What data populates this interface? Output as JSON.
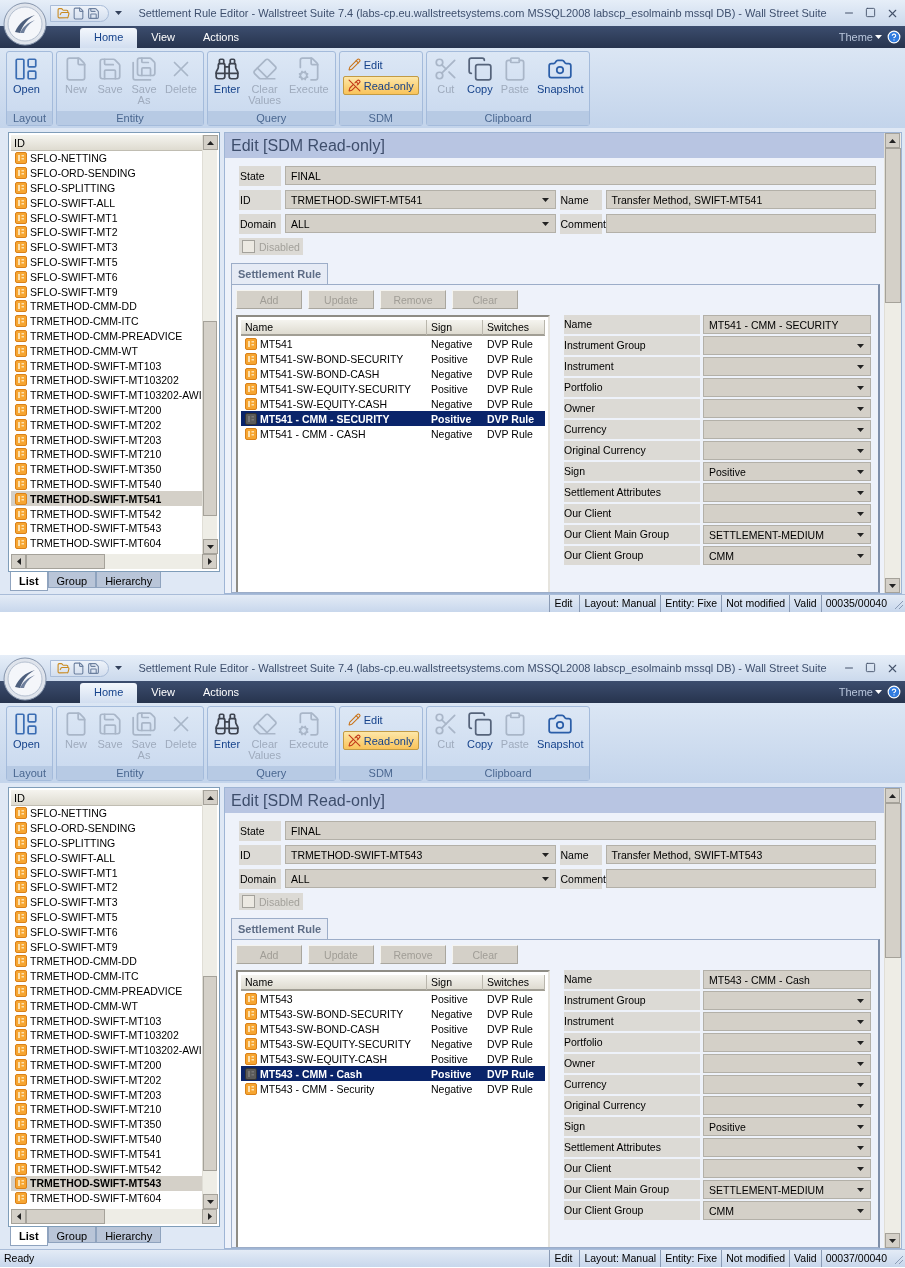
{
  "windows": [
    {
      "title": "Settlement Rule Editor - Wallstreet Suite 7.4 (labs-cp.eu.wallstreetsystems.com MSSQL2008 labscp_esolmainb mssql DB) - Wall Street Suite",
      "ribbon": {
        "tabs": [
          {
            "label": "Home",
            "selected": true
          },
          {
            "label": "View",
            "selected": false
          },
          {
            "label": "Actions",
            "selected": false
          }
        ],
        "theme": "Theme",
        "groups": [
          {
            "label": "Layout",
            "kind": "large",
            "buttons": [
              {
                "label": "Open",
                "disabled": false
              }
            ]
          },
          {
            "label": "Entity",
            "kind": "large",
            "buttons": [
              {
                "label": "New",
                "disabled": true
              },
              {
                "label": "Save",
                "disabled": true
              },
              {
                "label": "Save\nAs",
                "disabled": true
              },
              {
                "label": "Delete",
                "disabled": true
              }
            ]
          },
          {
            "label": "Query",
            "kind": "large",
            "buttons": [
              {
                "label": "Enter",
                "disabled": false
              },
              {
                "label": "Clear\nValues",
                "disabled": true
              },
              {
                "label": "Execute",
                "disabled": true
              }
            ]
          },
          {
            "label": "SDM",
            "kind": "toggles",
            "buttons": [
              {
                "label": "Edit",
                "selected": false
              },
              {
                "label": "Read-only",
                "selected": true
              }
            ]
          },
          {
            "label": "Clipboard",
            "kind": "large",
            "buttons": [
              {
                "label": "Cut",
                "disabled": true
              },
              {
                "label": "Copy",
                "disabled": false
              },
              {
                "label": "Paste",
                "disabled": true
              },
              {
                "label": "Snapshot",
                "disabled": false
              }
            ]
          }
        ]
      },
      "sidebar": {
        "column": "ID",
        "items": [
          {
            "label": "SFLO-NETTING",
            "selected": false
          },
          {
            "label": "SFLO-ORD-SENDING",
            "selected": false
          },
          {
            "label": "SFLO-SPLITTING",
            "selected": false
          },
          {
            "label": "SFLO-SWIFT-ALL",
            "selected": false
          },
          {
            "label": "SFLO-SWIFT-MT1",
            "selected": false
          },
          {
            "label": "SFLO-SWIFT-MT2",
            "selected": false
          },
          {
            "label": "SFLO-SWIFT-MT3",
            "selected": false
          },
          {
            "label": "SFLO-SWIFT-MT5",
            "selected": false
          },
          {
            "label": "SFLO-SWIFT-MT6",
            "selected": false
          },
          {
            "label": "SFLO-SWIFT-MT9",
            "selected": false
          },
          {
            "label": "TRMETHOD-CMM-DD",
            "selected": false
          },
          {
            "label": "TRMETHOD-CMM-ITC",
            "selected": false
          },
          {
            "label": "TRMETHOD-CMM-PREADVICE",
            "selected": false
          },
          {
            "label": "TRMETHOD-CMM-WT",
            "selected": false
          },
          {
            "label": "TRMETHOD-SWIFT-MT103",
            "selected": false
          },
          {
            "label": "TRMETHOD-SWIFT-MT103202",
            "selected": false
          },
          {
            "label": "TRMETHOD-SWIFT-MT103202-AWI",
            "selected": false
          },
          {
            "label": "TRMETHOD-SWIFT-MT200",
            "selected": false
          },
          {
            "label": "TRMETHOD-SWIFT-MT202",
            "selected": false
          },
          {
            "label": "TRMETHOD-SWIFT-MT203",
            "selected": false
          },
          {
            "label": "TRMETHOD-SWIFT-MT210",
            "selected": false
          },
          {
            "label": "TRMETHOD-SWIFT-MT350",
            "selected": false
          },
          {
            "label": "TRMETHOD-SWIFT-MT540",
            "selected": false
          },
          {
            "label": "TRMETHOD-SWIFT-MT541",
            "selected": true
          },
          {
            "label": "TRMETHOD-SWIFT-MT542",
            "selected": false
          },
          {
            "label": "TRMETHOD-SWIFT-MT543",
            "selected": false
          },
          {
            "label": "TRMETHOD-SWIFT-MT604",
            "selected": false
          }
        ],
        "tabs": [
          {
            "label": "List",
            "selected": true
          },
          {
            "label": "Group",
            "selected": false
          },
          {
            "label": "Hierarchy",
            "selected": false
          }
        ]
      },
      "editor": {
        "heading": "Edit [SDM Read-only]",
        "form_rows": [
          [
            {
              "label": "State",
              "value": "FINAL",
              "kind": "text"
            }
          ],
          [
            {
              "label": "ID",
              "value": "TRMETHOD-SWIFT-MT541",
              "kind": "dropdown"
            },
            {
              "label": "Name",
              "value": "Transfer Method, SWIFT-MT541",
              "kind": "text"
            }
          ],
          [
            {
              "label": "Domain",
              "value": "ALL",
              "kind": "dropdown"
            },
            {
              "label": "Comment",
              "kind": "text"
            }
          ]
        ],
        "checkbox": {
          "label": "Disabled",
          "checked": false,
          "disabled": true
        },
        "tab": "Settlement Rule",
        "actions": [
          {
            "label": "Add",
            "disabled": true
          },
          {
            "label": "Update",
            "disabled": true
          },
          {
            "label": "Remove",
            "disabled": true
          },
          {
            "label": "Clear",
            "disabled": true
          }
        ],
        "rules": {
          "columns": [
            "Name",
            "Sign",
            "Switches"
          ],
          "rows": [
            {
              "name": "MT541",
              "sign": "Negative",
              "switches": "DVP Rule",
              "selected": false
            },
            {
              "name": "MT541-SW-BOND-SECURITY",
              "sign": "Positive",
              "switches": "DVP Rule",
              "selected": false
            },
            {
              "name": "MT541-SW-BOND-CASH",
              "sign": "Negative",
              "switches": "DVP Rule",
              "selected": false
            },
            {
              "name": "MT541-SW-EQUITY-SECURITY",
              "sign": "Positive",
              "switches": "DVP Rule",
              "selected": false
            },
            {
              "name": "MT541-SW-EQUITY-CASH",
              "sign": "Negative",
              "switches": "DVP Rule",
              "selected": false
            },
            {
              "name": "MT541 - CMM - SECURITY",
              "sign": "Positive",
              "switches": "DVP Rule",
              "selected": true
            },
            {
              "name": "MT541 - CMM - CASH",
              "sign": "Negative",
              "switches": "DVP Rule",
              "selected": false
            }
          ]
        },
        "properties": [
          {
            "label": "Name",
            "value": "MT541 - CMM - SECURITY",
            "kind": "text"
          },
          {
            "label": "Instrument Group",
            "kind": "dropdown"
          },
          {
            "label": "Instrument",
            "kind": "dropdown"
          },
          {
            "label": "Portfolio",
            "kind": "dropdown"
          },
          {
            "label": "Owner",
            "kind": "dropdown"
          },
          {
            "label": "Currency",
            "kind": "dropdown"
          },
          {
            "label": "Original Currency",
            "kind": "dropdown"
          },
          {
            "label": "Sign",
            "value": "Positive",
            "kind": "dropdown"
          },
          {
            "label": "Settlement Attributes",
            "kind": "dropdown"
          },
          {
            "label": "Our Client",
            "kind": "dropdown"
          },
          {
            "label": "Our Client Main Group",
            "value": "SETTLEMENT-MEDIUM",
            "kind": "dropdown"
          },
          {
            "label": "Our Client Group",
            "value": "CMM",
            "kind": "dropdown"
          }
        ]
      },
      "status_bar": {
        "cells": [
          "Edit",
          "Layout: Manual",
          "Entity: Fixe",
          "Not modified",
          "Valid",
          "00035/00040"
        ]
      }
    },
    {
      "title": "Settlement Rule Editor - Wallstreet Suite 7.4 (labs-cp.eu.wallstreetsystems.com MSSQL2008 labscp_esolmainb mssql DB) - Wall Street Suite",
      "ribbon": {
        "tabs": [
          {
            "label": "Home",
            "selected": true
          },
          {
            "label": "View",
            "selected": false
          },
          {
            "label": "Actions",
            "selected": false
          }
        ],
        "theme": "Theme",
        "groups": [
          {
            "label": "Layout",
            "kind": "large",
            "buttons": [
              {
                "label": "Open",
                "disabled": false
              }
            ]
          },
          {
            "label": "Entity",
            "kind": "large",
            "buttons": [
              {
                "label": "New",
                "disabled": true
              },
              {
                "label": "Save",
                "disabled": true
              },
              {
                "label": "Save\nAs",
                "disabled": true
              },
              {
                "label": "Delete",
                "disabled": true
              }
            ]
          },
          {
            "label": "Query",
            "kind": "large",
            "buttons": [
              {
                "label": "Enter",
                "disabled": false
              },
              {
                "label": "Clear\nValues",
                "disabled": true
              },
              {
                "label": "Execute",
                "disabled": true
              }
            ]
          },
          {
            "label": "SDM",
            "kind": "toggles",
            "buttons": [
              {
                "label": "Edit",
                "selected": false
              },
              {
                "label": "Read-only",
                "selected": true
              }
            ]
          },
          {
            "label": "Clipboard",
            "kind": "large",
            "buttons": [
              {
                "label": "Cut",
                "disabled": true
              },
              {
                "label": "Copy",
                "disabled": false
              },
              {
                "label": "Paste",
                "disabled": true
              },
              {
                "label": "Snapshot",
                "disabled": false
              }
            ]
          }
        ]
      },
      "sidebar": {
        "column": "ID",
        "items": [
          {
            "label": "SFLO-NETTING",
            "selected": false
          },
          {
            "label": "SFLO-ORD-SENDING",
            "selected": false
          },
          {
            "label": "SFLO-SPLITTING",
            "selected": false
          },
          {
            "label": "SFLO-SWIFT-ALL",
            "selected": false
          },
          {
            "label": "SFLO-SWIFT-MT1",
            "selected": false
          },
          {
            "label": "SFLO-SWIFT-MT2",
            "selected": false
          },
          {
            "label": "SFLO-SWIFT-MT3",
            "selected": false
          },
          {
            "label": "SFLO-SWIFT-MT5",
            "selected": false
          },
          {
            "label": "SFLO-SWIFT-MT6",
            "selected": false
          },
          {
            "label": "SFLO-SWIFT-MT9",
            "selected": false
          },
          {
            "label": "TRMETHOD-CMM-DD",
            "selected": false
          },
          {
            "label": "TRMETHOD-CMM-ITC",
            "selected": false
          },
          {
            "label": "TRMETHOD-CMM-PREADVICE",
            "selected": false
          },
          {
            "label": "TRMETHOD-CMM-WT",
            "selected": false
          },
          {
            "label": "TRMETHOD-SWIFT-MT103",
            "selected": false
          },
          {
            "label": "TRMETHOD-SWIFT-MT103202",
            "selected": false
          },
          {
            "label": "TRMETHOD-SWIFT-MT103202-AWI",
            "selected": false
          },
          {
            "label": "TRMETHOD-SWIFT-MT200",
            "selected": false
          },
          {
            "label": "TRMETHOD-SWIFT-MT202",
            "selected": false
          },
          {
            "label": "TRMETHOD-SWIFT-MT203",
            "selected": false
          },
          {
            "label": "TRMETHOD-SWIFT-MT210",
            "selected": false
          },
          {
            "label": "TRMETHOD-SWIFT-MT350",
            "selected": false
          },
          {
            "label": "TRMETHOD-SWIFT-MT540",
            "selected": false
          },
          {
            "label": "TRMETHOD-SWIFT-MT541",
            "selected": false
          },
          {
            "label": "TRMETHOD-SWIFT-MT542",
            "selected": false
          },
          {
            "label": "TRMETHOD-SWIFT-MT543",
            "selected": true
          },
          {
            "label": "TRMETHOD-SWIFT-MT604",
            "selected": false
          }
        ],
        "tabs": [
          {
            "label": "List",
            "selected": true
          },
          {
            "label": "Group",
            "selected": false
          },
          {
            "label": "Hierarchy",
            "selected": false
          }
        ]
      },
      "editor": {
        "heading": "Edit [SDM Read-only]",
        "form_rows": [
          [
            {
              "label": "State",
              "value": "FINAL",
              "kind": "text"
            }
          ],
          [
            {
              "label": "ID",
              "value": "TRMETHOD-SWIFT-MT543",
              "kind": "dropdown"
            },
            {
              "label": "Name",
              "value": "Transfer Method, SWIFT-MT543",
              "kind": "text"
            }
          ],
          [
            {
              "label": "Domain",
              "value": "ALL",
              "kind": "dropdown"
            },
            {
              "label": "Comment",
              "kind": "text"
            }
          ]
        ],
        "checkbox": {
          "label": "Disabled",
          "checked": false,
          "disabled": true
        },
        "tab": "Settlement Rule",
        "actions": [
          {
            "label": "Add",
            "disabled": true
          },
          {
            "label": "Update",
            "disabled": true
          },
          {
            "label": "Remove",
            "disabled": true
          },
          {
            "label": "Clear",
            "disabled": true
          }
        ],
        "rules": {
          "columns": [
            "Name",
            "Sign",
            "Switches"
          ],
          "rows": [
            {
              "name": "MT543",
              "sign": "Positive",
              "switches": "DVP Rule",
              "selected": false
            },
            {
              "name": "MT543-SW-BOND-SECURITY",
              "sign": "Negative",
              "switches": "DVP Rule",
              "selected": false
            },
            {
              "name": "MT543-SW-BOND-CASH",
              "sign": "Positive",
              "switches": "DVP Rule",
              "selected": false
            },
            {
              "name": "MT543-SW-EQUITY-SECURITY",
              "sign": "Negative",
              "switches": "DVP Rule",
              "selected": false
            },
            {
              "name": "MT543-SW-EQUITY-CASH",
              "sign": "Positive",
              "switches": "DVP Rule",
              "selected": false
            },
            {
              "name": "MT543 - CMM - Cash",
              "sign": "Positive",
              "switches": "DVP Rule",
              "selected": true
            },
            {
              "name": "MT543 - CMM - Security",
              "sign": "Negative",
              "switches": "DVP Rule",
              "selected": false
            }
          ]
        },
        "properties": [
          {
            "label": "Name",
            "value": "MT543 - CMM - Cash",
            "kind": "text"
          },
          {
            "label": "Instrument Group",
            "kind": "dropdown"
          },
          {
            "label": "Instrument",
            "kind": "dropdown"
          },
          {
            "label": "Portfolio",
            "kind": "dropdown"
          },
          {
            "label": "Owner",
            "kind": "dropdown"
          },
          {
            "label": "Currency",
            "kind": "dropdown"
          },
          {
            "label": "Original Currency",
            "kind": "dropdown"
          },
          {
            "label": "Sign",
            "value": "Positive",
            "kind": "dropdown"
          },
          {
            "label": "Settlement Attributes",
            "kind": "dropdown"
          },
          {
            "label": "Our Client",
            "kind": "dropdown"
          },
          {
            "label": "Our Client Main Group",
            "value": "SETTLEMENT-MEDIUM",
            "kind": "dropdown"
          },
          {
            "label": "Our Client Group",
            "value": "CMM",
            "kind": "dropdown"
          }
        ]
      },
      "status_bar": {
        "message": "Ready",
        "cells": [
          "Edit",
          "Layout: Manual",
          "Entity: Fixe",
          "Not modified",
          "Valid",
          "00037/00040"
        ]
      }
    }
  ]
}
